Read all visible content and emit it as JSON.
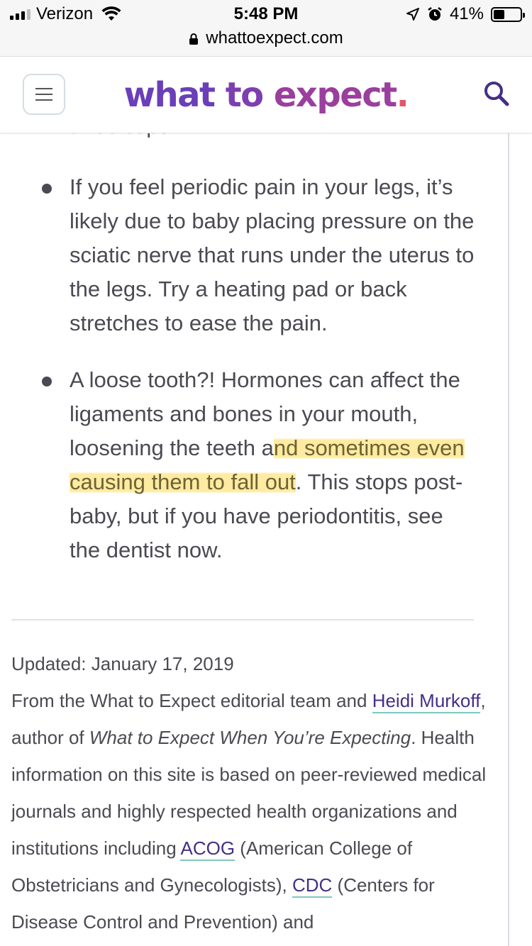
{
  "status_bar": {
    "carrier": "Verizon",
    "time": "5:48 PM",
    "battery_percent": "41%",
    "battery_level": 0.41,
    "url": "whattoexpect.com"
  },
  "header": {
    "logo_part1": "what",
    "logo_part2": "to",
    "logo_part3": "expect",
    "logo_dot": ".",
    "brand_colors": [
      "#6a3fb8",
      "#9a3f9e",
      "#e4576a"
    ]
  },
  "article": {
    "cutoff_text": "three cups!",
    "bullets": [
      {
        "text": "If you feel periodic pain in your legs, it’s likely due to baby placing pressure on the sciatic nerve that runs under the uterus to the legs. Try a heating pad or back stretches to ease the pain."
      },
      {
        "text_before": "A loose tooth?! Hormones can affect the ligaments and bones in your mouth, loosening the teeth a",
        "text_highlighted": "nd sometimes even causing them to fall out",
        "text_after": ". This stops post-baby, but if you have periodontitis, see the dentist now."
      }
    ]
  },
  "meta": {
    "updated": "Updated: January 17, 2019",
    "byline_pre": "From the What to Expect editorial team and ",
    "author_link": "Heidi Murkoff",
    "byline_mid": ", author of ",
    "book_title": "What to Expect When You’re Expecting",
    "body_1": ". Health information on this site is based on peer-reviewed medical journals and highly respected health organizations and institutions including ",
    "link_acog": "ACOG",
    "body_2": " (American College of Obstetricians and Gynecologists), ",
    "link_cdc": "CDC",
    "body_3": " (Centers for Disease Control and Prevention) and"
  },
  "colors": {
    "highlight": "#fde482",
    "link": "#452f85",
    "link_underline": "#7fc7c1"
  }
}
